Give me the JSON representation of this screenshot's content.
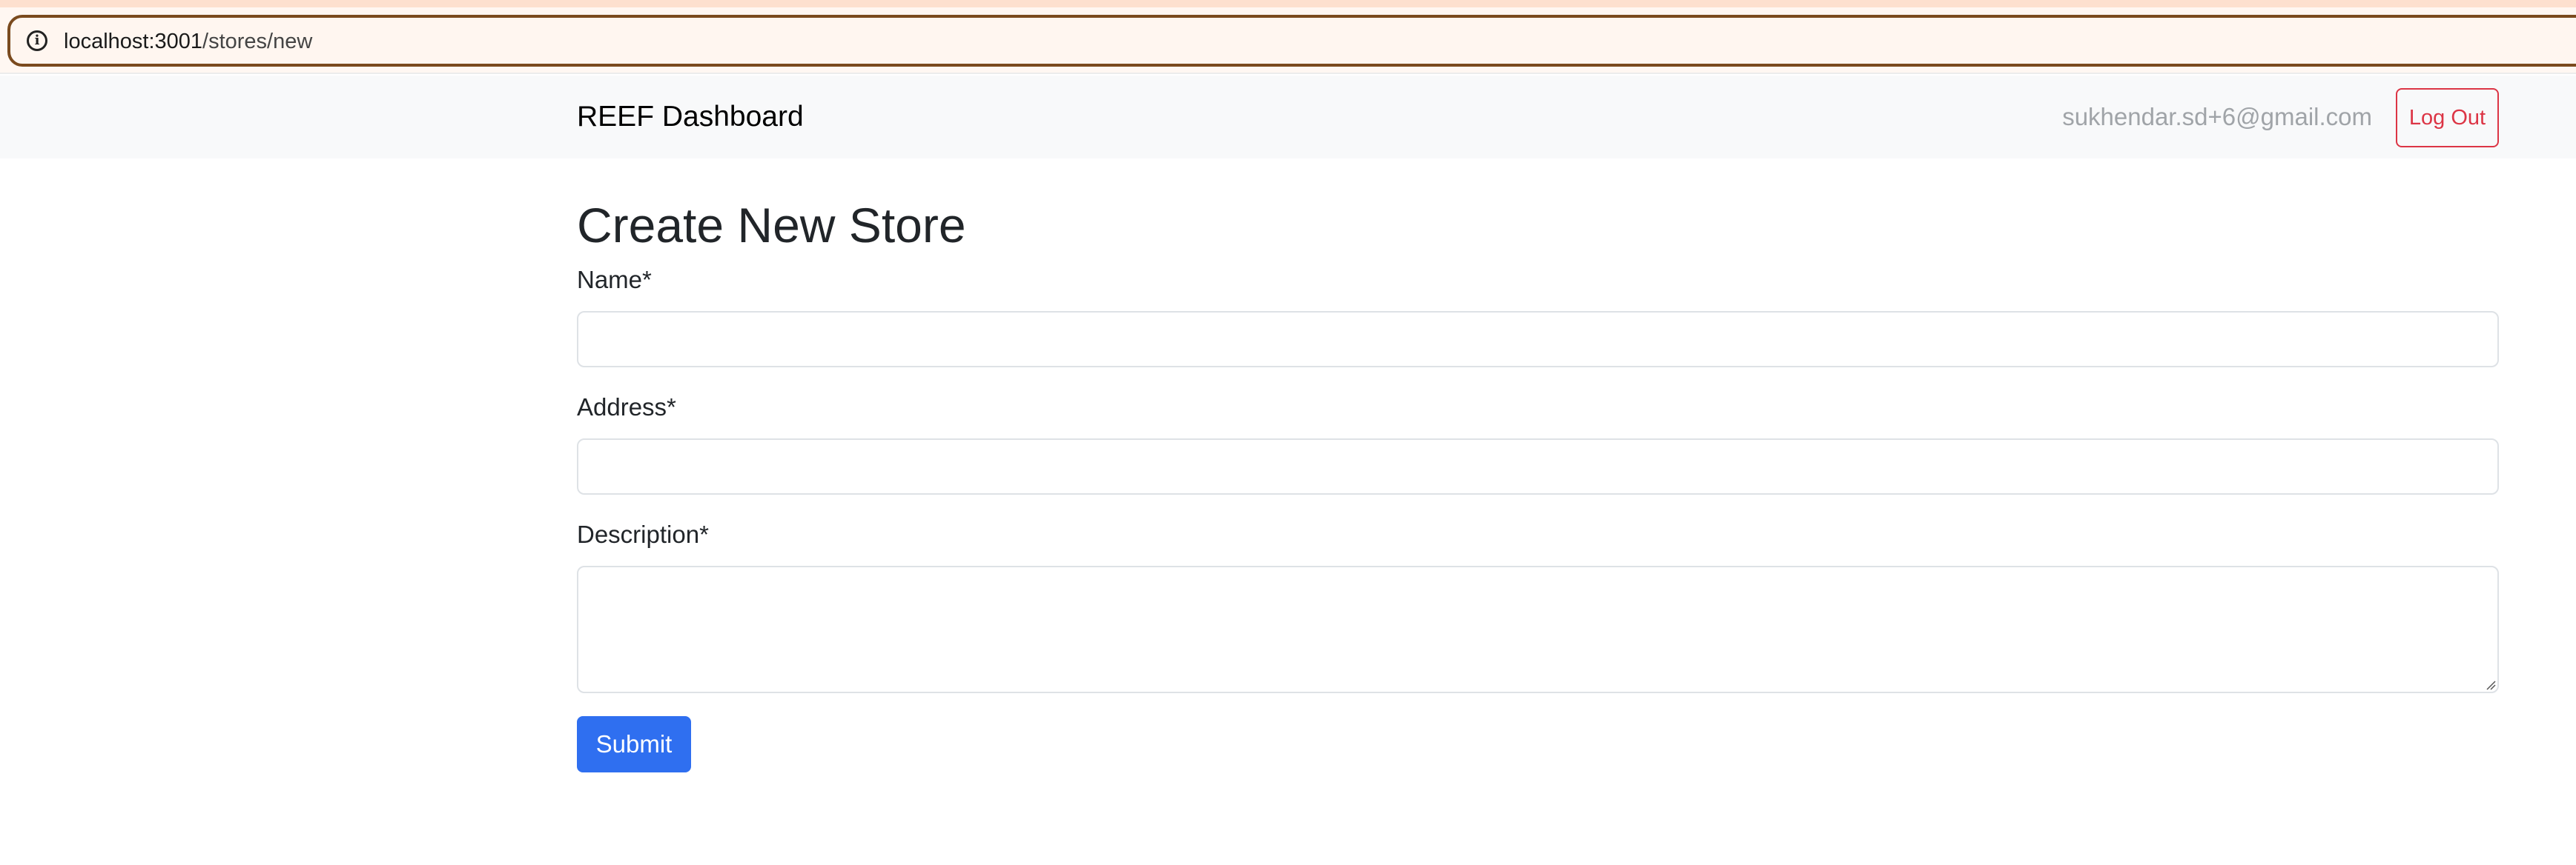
{
  "browser": {
    "url_host": "localhost:3001",
    "url_path": "/stores/new",
    "info_icon": "info-circle-icon"
  },
  "navbar": {
    "brand": "REEF Dashboard",
    "user_email": "sukhendar.sd+6@gmail.com",
    "logout_label": "Log Out"
  },
  "form": {
    "title": "Create New Store",
    "fields": [
      {
        "label": "Name*",
        "value": ""
      },
      {
        "label": "Address*",
        "value": ""
      },
      {
        "label": "Description*",
        "value": ""
      }
    ],
    "submit_label": "Submit"
  },
  "colors": {
    "primary": "#2f6ff0",
    "danger": "#dc3545",
    "navbar_bg": "#f8f9fa",
    "muted_text": "#a0a4a8"
  }
}
